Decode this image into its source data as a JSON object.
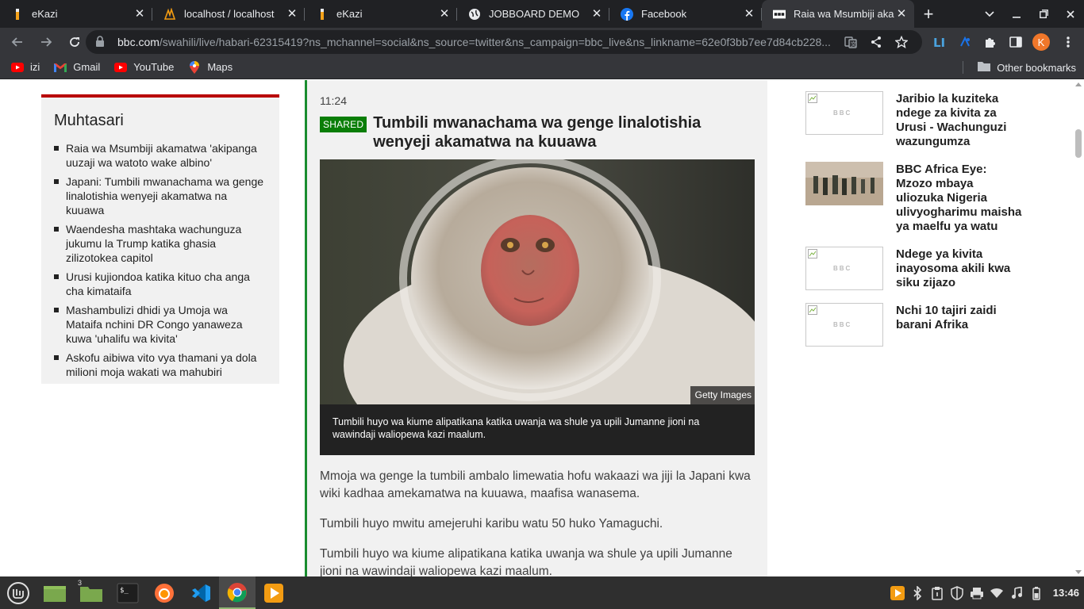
{
  "tabs": [
    {
      "title": "eKazi",
      "icon": "ekazi-icon"
    },
    {
      "title": "localhost / localhost",
      "icon": "phpmyadmin-icon"
    },
    {
      "title": "eKazi",
      "icon": "ekazi-icon"
    },
    {
      "title": "JOBBOARD DEMO",
      "icon": "globe-icon"
    },
    {
      "title": "Facebook",
      "icon": "facebook-icon"
    },
    {
      "title": "Raia wa Msumbiji aka",
      "icon": "bbc-icon"
    }
  ],
  "address": {
    "domain": "bbc.com",
    "path": "/swahili/live/habari-62315419?ns_mchannel=social&ns_source=twitter&ns_campaign=bbc_live&ns_linkname=62e0f3bb7ee7d84cb228..."
  },
  "profile_initial": "K",
  "bookmarks": [
    {
      "label": "izi",
      "icon": "youtube-icon"
    },
    {
      "label": "Gmail",
      "icon": "gmail-icon"
    },
    {
      "label": "YouTube",
      "icon": "youtube-icon"
    },
    {
      "label": "Maps",
      "icon": "maps-icon"
    }
  ],
  "other_bookmarks": "Other bookmarks",
  "summary": {
    "title": "Muhtasari",
    "items": [
      "Raia wa Msumbiji akamatwa 'akipanga uuzaji wa watoto wake albino'",
      "Japani: Tumbili mwanachama wa genge linalotishia wenyeji akamatwa na kuuawa",
      "Waendesha mashtaka wachunguza jukumu la Trump katika ghasia zilizotokea capitol",
      "Urusi kujiondoa katika kituo cha anga cha kimataifa",
      "Mashambulizi dhidi ya Umoja wa Mataifa nchini DR Congo yanaweza kuwa 'uhalifu wa kivita'",
      "Askofu aibiwa vito vya thamani ya dola milioni moja wakati wa mahubiri"
    ]
  },
  "post": {
    "time": "11:24",
    "badge": "SHARED",
    "headline": "Tumbili mwanachama wa genge linalotishia wenyeji akamatwa na kuuawa",
    "credit": "Getty Images",
    "caption": "Tumbili huyo wa kiume alipatikana katika uwanja wa shule ya upili Jumanne jioni na wawindaji waliopewa kazi maalum.",
    "paragraphs": [
      "Mmoja wa genge la tumbili ambalo limewatia hofu wakaazi wa jiji la Japani kwa wiki kadhaa amekamatwa na kuuawa, maafisa wanasema.",
      "Tumbili huyo mwitu amejeruhi karibu watu 50 huko Yamaguchi.",
      "Tumbili huyo wa kiume alipatikana katika uwanja wa shule ya upili Jumanne jioni na wawindaji waliopewa kazi maalum."
    ]
  },
  "related": [
    {
      "title": "Jaribio la kuziteka ndege za kivita za Urusi - Wachunguzi wazungumza",
      "thumb": "placeholder"
    },
    {
      "title": "BBC Africa Eye: Mzozo mbaya uliozuka Nigeria ulivyogharimu maisha ya maelfu ya watu",
      "thumb": "photo"
    },
    {
      "title": "Ndege ya kivita inayosoma akili kwa siku zijazo",
      "thumb": "placeholder"
    },
    {
      "title": "Nchi 10 tajiri zaidi barani Afrika",
      "thumb": "placeholder"
    }
  ],
  "taskbar": {
    "files_count": "3",
    "clock": "13:46"
  },
  "colors": {
    "bbc_red": "#b80000",
    "shared_green": "#0a7e07",
    "feed_border": "#1a8c2f"
  }
}
